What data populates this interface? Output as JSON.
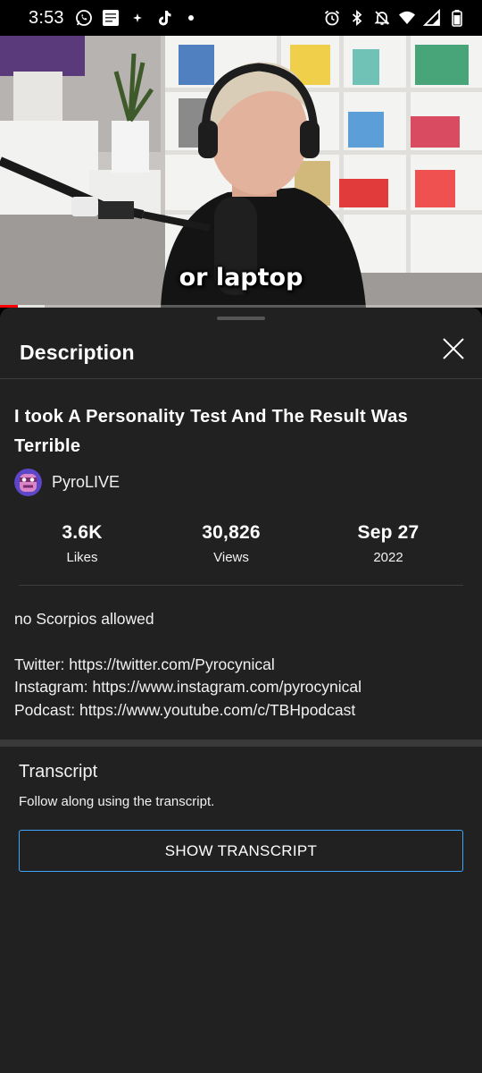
{
  "status_bar": {
    "time": "3:53",
    "left_icons": [
      "whatsapp-icon",
      "bible-app-icon",
      "sparkle-icon",
      "tiktok-icon",
      "dot-icon"
    ],
    "right_icons": [
      "alarm-icon",
      "bluetooth-icon",
      "mute-icon",
      "wifi-icon",
      "signal-icon",
      "battery-icon"
    ]
  },
  "video": {
    "caption": "or laptop",
    "progress_fraction": 0.037,
    "buffer_fraction": 0.093
  },
  "sheet": {
    "title": "Description",
    "close_icon": "close-icon"
  },
  "video_info": {
    "title": "I took A Personality Test And The Result Was Terrible",
    "channel": "PyroLIVE"
  },
  "stats": [
    {
      "value": "3.6K",
      "label": "Likes"
    },
    {
      "value": "30,826",
      "label": "Views"
    },
    {
      "value": "Sep 27",
      "label": "2022"
    }
  ],
  "description": {
    "line1": "no Scorpios allowed",
    "line2": "Twitter: https://twitter.com/Pyrocynical",
    "line3": "Instagram: https://www.instagram.com/pyrocynical",
    "line4": "Podcast: https://www.youtube.com/c/TBHpodcast"
  },
  "transcript": {
    "title": "Transcript",
    "subtitle": "Follow along using the transcript.",
    "button_label": "SHOW TRANSCRIPT"
  },
  "colors": {
    "sheet_bg": "#212121",
    "accent_blue": "#3ea6ff",
    "progress_red": "#ff0000"
  }
}
